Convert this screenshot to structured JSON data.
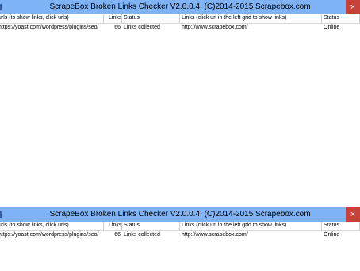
{
  "windows": [
    {
      "title": "ScrapeBox Broken Links Checker V2.0.0.4, (C)2014-2015 Scrapebox.com",
      "close_glyph": "×",
      "left_headers": {
        "urls": "urls (to show links, click urls)",
        "links": "Links",
        "status": "Status"
      },
      "right_headers": {
        "links": "Links (click url in the left grid to show links)",
        "status": "Status"
      },
      "rows": [
        {
          "url": "https://yoast.com/wordpress/plugins/seo/",
          "links": "66",
          "status": "Links collected",
          "link_url": "http://www.scrapebox.com/",
          "link_status": "Online"
        }
      ]
    },
    {
      "title": "ScrapeBox Broken Links Checker V2.0.0.4, (C)2014-2015 Scrapebox.com",
      "close_glyph": "×",
      "left_headers": {
        "urls": "urls (to show links, click urls)",
        "links": "Links",
        "status": "Status"
      },
      "right_headers": {
        "links": "Links (click url in the left grid to show links)",
        "status": "Status"
      },
      "rows": [
        {
          "url": "https://yoast.com/wordpress/plugins/seo/",
          "links": "66",
          "status": "Links collected",
          "link_url": "http://www.scrapebox.com/",
          "link_status": "Online"
        }
      ]
    }
  ],
  "colors": {
    "titlebar": "#7fb3f5",
    "close": "#c7413a"
  }
}
